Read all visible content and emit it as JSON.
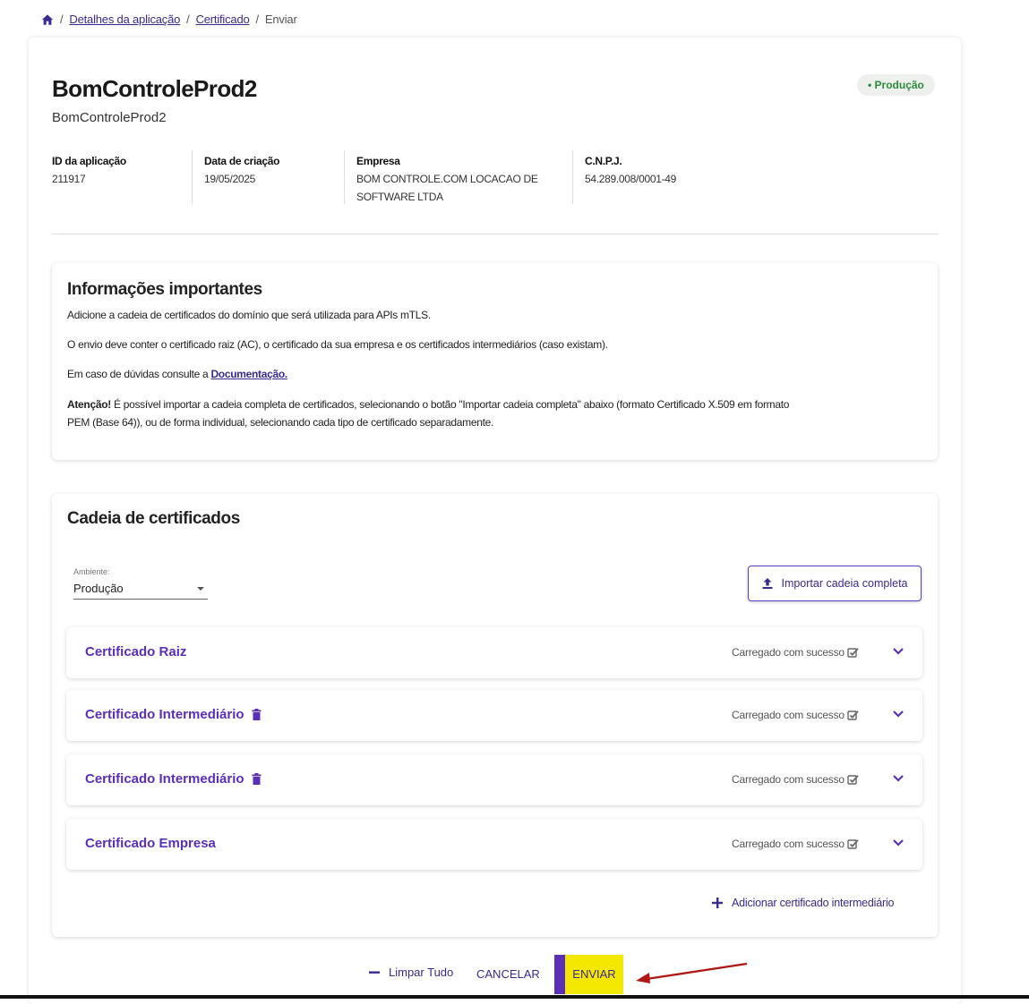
{
  "breadcrumb": {
    "items": [
      "Detalhes da aplicação",
      "Certificado"
    ],
    "current": "Enviar",
    "separator": "/"
  },
  "app": {
    "title": "BomControleProd2",
    "subtitle": "BomControleProd2",
    "badge": "• Produção",
    "meta": [
      {
        "label": "ID da aplicação",
        "value": "211917"
      },
      {
        "label": "Data de criação",
        "value": "19/05/2025"
      },
      {
        "label": "Empresa",
        "value_line1": "BOM CONTROLE.COM LOCACAO DE",
        "value_line2": "SOFTWARE LTDA"
      },
      {
        "label": "C.N.P.J.",
        "value": "54.289.008/0001-49"
      }
    ]
  },
  "info": {
    "title": "Informações importantes",
    "p1": "Adicione a cadeia de certificados do domínio que será utilizada para APIs mTLS.",
    "p2": "O envio deve conter o certificado raiz (AC), o certificado da sua empresa e os certificados intermediários (caso existam).",
    "p3_prefix": "Em caso de dúvidas consulte a ",
    "p3_link": "Documentação.",
    "p4_bold": "Atenção!",
    "p4_line1": " É possível importar a cadeia completa de certificados, selecionando o botão \"Importar cadeia completa\" abaixo (formato Certificado X.509 em formato",
    "p4_line2": "PEM (Base 64)), ou de forma individual, selecionando cada tipo de certificado separadamente."
  },
  "chain": {
    "title": "Cadeia de certificados",
    "env_label": "Ambiente:",
    "env_value": "Produção",
    "import_label": "Importar cadeia completa",
    "certs": [
      {
        "title": "Certificado Raiz",
        "status": "Carregado com sucesso"
      },
      {
        "title": "Certificado Intermediário",
        "status": "Carregado com sucesso"
      },
      {
        "title": "Certificado Intermediário",
        "status": "Carregado com sucesso"
      },
      {
        "title": "Certificado Empresa",
        "status": "Carregado com sucesso"
      }
    ],
    "add_label": "Adicionar certificado intermediário"
  },
  "actions": {
    "clear_label": "Limpar Tudo",
    "cancel_label": "CANCELAR",
    "send_label": "ENVIAR"
  },
  "colors": {
    "accent": "#5b2fb8",
    "link": "#3b2a8f",
    "send_bg": "#f5e800",
    "badge_text": "#2e8b3e",
    "annotation_arrow": "#b01818"
  },
  "icons": [
    "home-icon",
    "upload-icon",
    "trash-icon",
    "check-square-icon",
    "chevron-down-icon",
    "plus-icon",
    "minus-icon",
    "arrow-annotation"
  ]
}
